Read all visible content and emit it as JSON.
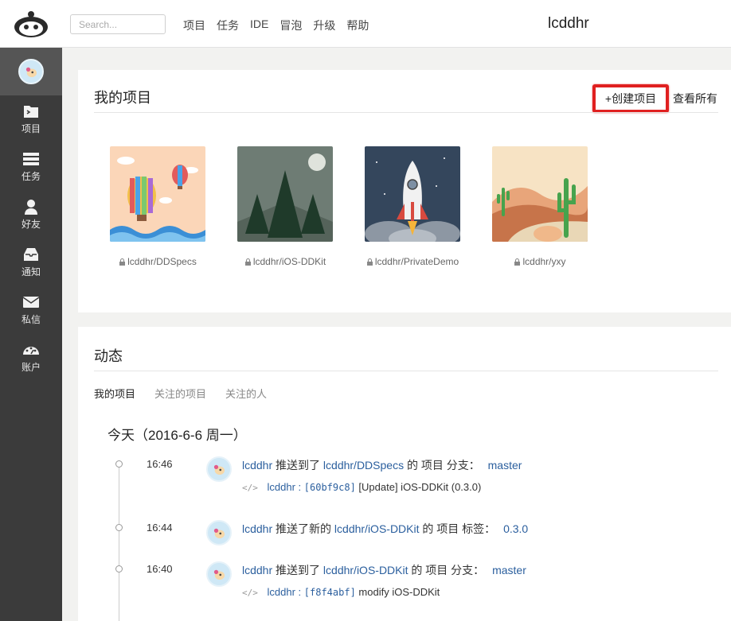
{
  "header": {
    "search_placeholder": "Search...",
    "nav": [
      "项目",
      "任务",
      "IDE",
      "冒泡",
      "升级",
      "帮助"
    ],
    "username": "lcddhr"
  },
  "sidebar": {
    "items": [
      {
        "label": "项目",
        "icon": "project-icon"
      },
      {
        "label": "任务",
        "icon": "task-icon"
      },
      {
        "label": "好友",
        "icon": "friend-icon"
      },
      {
        "label": "通知",
        "icon": "notification-icon"
      },
      {
        "label": "私信",
        "icon": "message-icon"
      },
      {
        "label": "账户",
        "icon": "account-icon"
      }
    ]
  },
  "projects": {
    "title": "我的项目",
    "create_label": "+创建项目",
    "view_all_label": "查看所有",
    "items": [
      {
        "name": "lcddhr/DDSpecs"
      },
      {
        "name": "lcddhr/iOS-DDKit"
      },
      {
        "name": "lcddhr/PrivateDemo"
      },
      {
        "name": "lcddhr/yxy"
      }
    ]
  },
  "activity": {
    "title": "动态",
    "tabs": [
      "我的项目",
      "关注的项目",
      "关注的人"
    ],
    "day_label": "今天（2016-6-6 周一）",
    "events": [
      {
        "time": "16:46",
        "user": "lcddhr",
        "action": "推送到了",
        "project": "lcddhr/DDSpecs",
        "suffix": "的 项目 分支：",
        "ref": "master",
        "commit_user": "lcddhr :",
        "commit_hash": "[60bf9c8]",
        "commit_msg": "[Update] iOS-DDKit (0.3.0)"
      },
      {
        "time": "16:44",
        "user": "lcddhr",
        "action": "推送了新的",
        "project": "lcddhr/iOS-DDKit",
        "suffix": "的 项目 标签：",
        "ref": "0.3.0"
      },
      {
        "time": "16:40",
        "user": "lcddhr",
        "action": "推送到了",
        "project": "lcddhr/iOS-DDKit",
        "suffix": "的 项目 分支：",
        "ref": "master",
        "commit_user": "lcddhr :",
        "commit_hash": "[f8f4abf]",
        "commit_msg": "modify iOS-DDKit"
      }
    ]
  },
  "colors": {
    "link": "#2b5f9e",
    "highlight": "#e02020",
    "sidebar": "#3b3b3b"
  }
}
